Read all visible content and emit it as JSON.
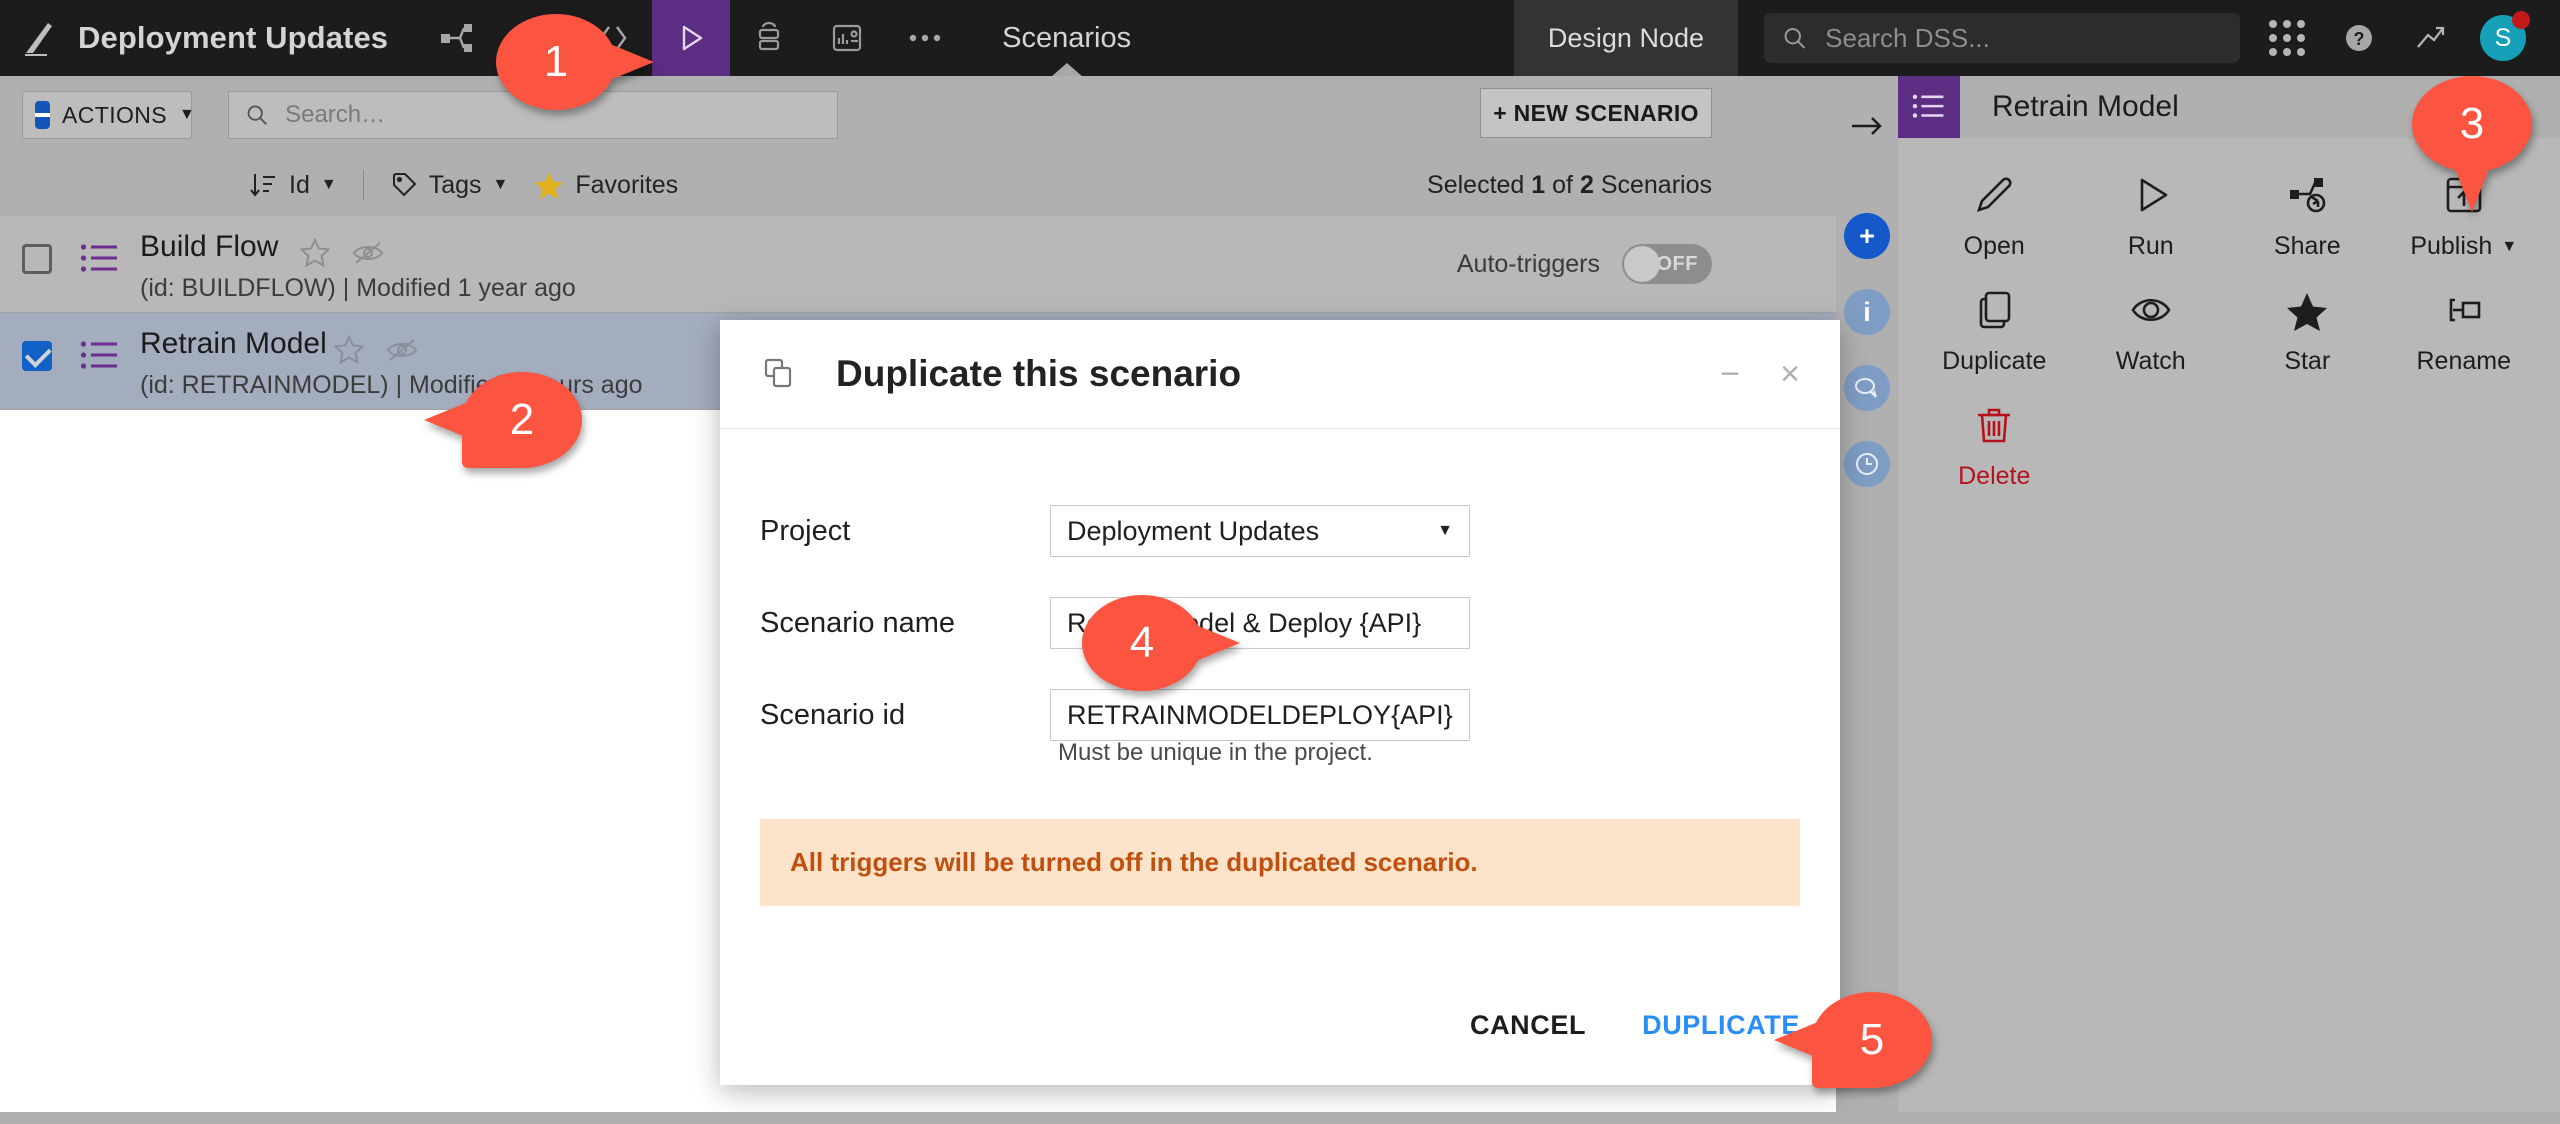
{
  "topbar": {
    "project_name": "Deployment Updates",
    "section_label": "Scenarios",
    "node_label": "Design Node",
    "search_placeholder": "Search DSS...",
    "avatar_initial": "S",
    "icons": [
      "flow-icon",
      "lab-icon",
      "code-icon",
      "scenarios-icon",
      "jobs-icon",
      "dashboard-icon",
      "more-icon"
    ]
  },
  "toolbar": {
    "actions_label": "ACTIONS",
    "search_placeholder": "Search…",
    "new_scenario_label": "+ NEW SCENARIO",
    "selected_prefix": "Selected",
    "selected_count": "1",
    "selected_of": "of",
    "selected_total": "2",
    "selected_suffix": "Scenarios"
  },
  "filterbar": {
    "sort_label": "Id",
    "tags_label": "Tags",
    "favorites_label": "Favorites"
  },
  "list": {
    "auto_triggers_label": "Auto-triggers",
    "auto_triggers_state": "OFF",
    "rows": [
      {
        "name": "Build Flow",
        "meta": "(id: BUILDFLOW) | Modified 1 year ago",
        "checked": false
      },
      {
        "name": "Retrain Model",
        "meta": "(id: RETRAINMODEL) | Modified 3 hours ago",
        "checked": true
      }
    ]
  },
  "right_panel": {
    "title": "Retrain Model",
    "actions": [
      {
        "label": "Open",
        "icon": "pencil-icon"
      },
      {
        "label": "Run",
        "icon": "play-icon"
      },
      {
        "label": "Share",
        "icon": "share-icon"
      },
      {
        "label": "Publish",
        "icon": "publish-icon"
      },
      {
        "label": "Duplicate",
        "icon": "duplicate-icon"
      },
      {
        "label": "Watch",
        "icon": "eye-icon"
      },
      {
        "label": "Star",
        "icon": "star-icon"
      },
      {
        "label": "Rename",
        "icon": "rename-icon"
      },
      {
        "label": "Delete",
        "icon": "trash-icon"
      }
    ]
  },
  "modal": {
    "title": "Duplicate this scenario",
    "project_label": "Project",
    "project_value": "Deployment Updates",
    "scenario_name_label": "Scenario name",
    "scenario_name_value": "Retrain Model & Deploy {API}",
    "scenario_id_label": "Scenario id",
    "scenario_id_value": "RETRAINMODELDEPLOY{API}",
    "hint": "Must be unique in the project.",
    "warning": "All triggers will be turned off in the duplicated scenario.",
    "cancel_label": "CANCEL",
    "duplicate_label": "DUPLICATE"
  },
  "callouts": [
    {
      "number": "1"
    },
    {
      "number": "2"
    },
    {
      "number": "3"
    },
    {
      "number": "4"
    },
    {
      "number": "5"
    }
  ],
  "colors": {
    "accent_purple": "#5c2e83",
    "accent_blue": "#1558c9",
    "link_blue": "#2b8ef5",
    "danger_red": "#b5121b",
    "warning_bg": "#fce3c9",
    "warning_text": "#c0500f",
    "callout_red": "#fb5440"
  }
}
